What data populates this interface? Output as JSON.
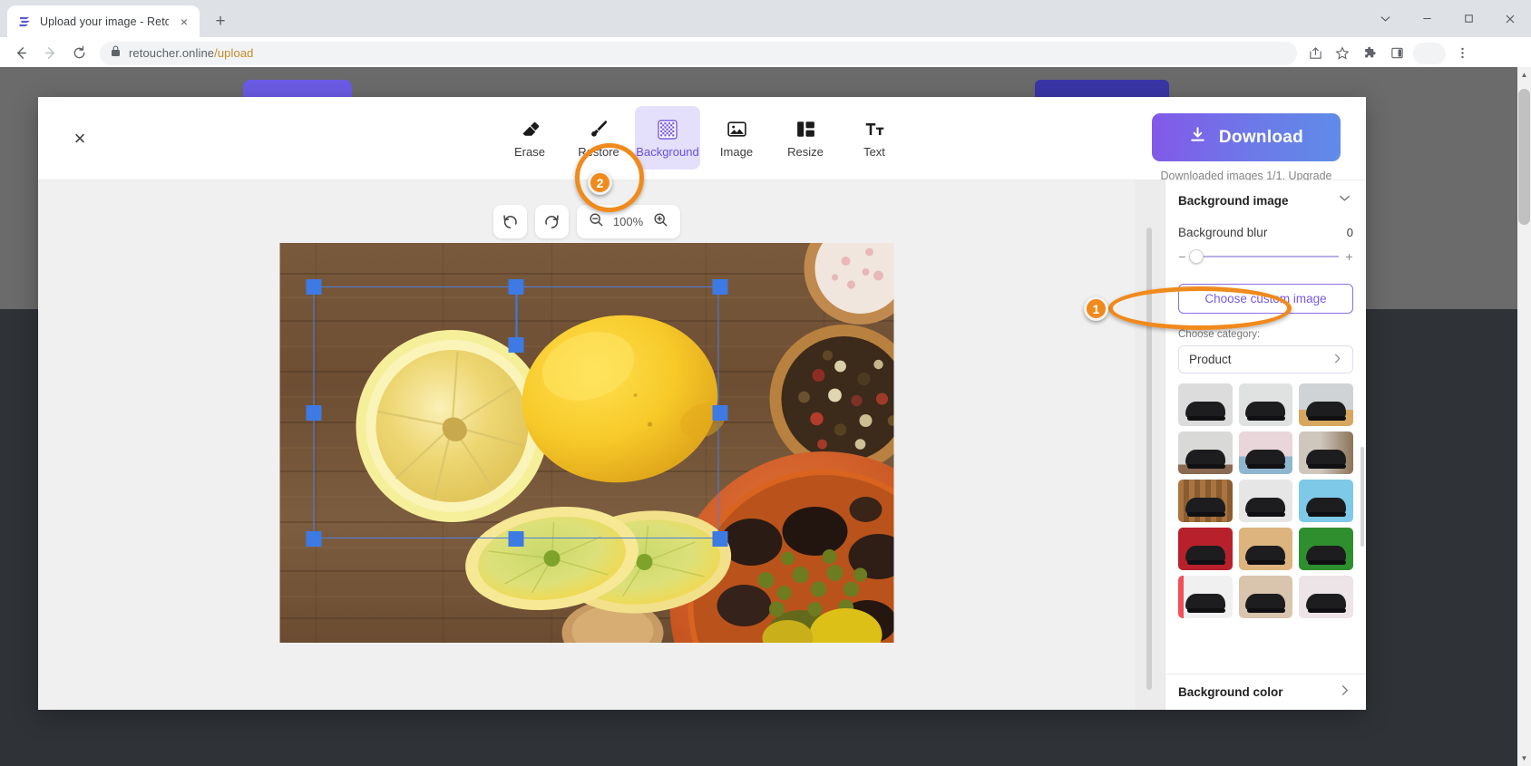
{
  "browser": {
    "tab": {
      "title": "Upload your image - Retoucher.",
      "favicon": "retoucher-logo-icon",
      "close": "×"
    },
    "new_tab_label": "+",
    "window_controls": [
      "chevron-down-icon",
      "minimize-icon",
      "maximize-icon",
      "close-icon"
    ],
    "nav": {
      "back": "←",
      "forward": "→",
      "reload": "⟳"
    },
    "omnibox": {
      "lock": "lock-icon",
      "domain": "retoucher.online",
      "path": "/upload",
      "url_full": "retoucher.online/upload"
    },
    "toolbar_icons": [
      "share-icon",
      "bookmark-star-icon",
      "extensions-puzzle-icon",
      "side-panel-icon",
      "more-menu-icon"
    ]
  },
  "modal": {
    "close_label": "×",
    "tools": [
      {
        "label": "Erase",
        "icon": "eraser-icon",
        "active": false
      },
      {
        "label": "Restore",
        "icon": "brush-icon",
        "active": false
      },
      {
        "label": "Background",
        "icon": "checkerboard-icon",
        "active": true
      },
      {
        "label": "Image",
        "icon": "picture-icon",
        "active": false
      },
      {
        "label": "Resize",
        "icon": "resize-icon",
        "active": false
      },
      {
        "label": "Text",
        "icon": "text-tt-icon",
        "active": false
      }
    ],
    "download": {
      "label": "Download",
      "icon": "download-arrow-icon",
      "note_prefix": "Downloaded images 1/1. ",
      "note_link": "Upgrade"
    },
    "canvas": {
      "undo_icon": "undo-icon",
      "redo_icon": "redo-icon",
      "zoom_out_icon": "zoom-out-icon",
      "zoom_in_icon": "zoom-in-icon",
      "zoom_level": "100%",
      "image_alt": "lemons-and-spices-on-wood-photo",
      "selection": "transform-selection-box"
    }
  },
  "panel": {
    "title": "Background image",
    "collapse_icon": "chevron-down-icon",
    "blur": {
      "label": "Background blur",
      "value": "0",
      "minus": "−",
      "plus": "+"
    },
    "choose_custom_label": "Choose custom image",
    "category": {
      "label": "Choose category:",
      "selected": "Product",
      "chevron": "chevron-right-icon"
    },
    "thumbnails": [
      {
        "name": "sneaker-grey-studio",
        "bg": "#dcdcdc",
        "accent": "#f1f1f1"
      },
      {
        "name": "sneaker-white-marble",
        "bg": "#dfe2e0",
        "accent": "#cfd6d2"
      },
      {
        "name": "sneaker-wood-tan",
        "bg": "#cfd3d6",
        "accent": "#d8a75f"
      },
      {
        "name": "sneaker-shelf-grey",
        "bg": "#d9d9d7",
        "accent": "#8a6a52"
      },
      {
        "name": "sneaker-pink-blue",
        "bg": "#e9d6da",
        "accent": "#8fb6cf"
      },
      {
        "name": "sneaker-room-window",
        "bg": "#cfc6bd",
        "accent": "#8c7358"
      },
      {
        "name": "sneaker-wood-plank",
        "bg": "#a9743f",
        "accent": "#8a5c30"
      },
      {
        "name": "sneaker-white-fabric",
        "bg": "#e6e6e6",
        "accent": "#d4d4d4"
      },
      {
        "name": "sneaker-blue-water",
        "bg": "#7ec8e8",
        "accent": "#a9dcf0"
      },
      {
        "name": "sneaker-red-cloth",
        "bg": "#b8202c",
        "accent": "#8f1620"
      },
      {
        "name": "sneaker-beige-sand",
        "bg": "#ddb37e",
        "accent": "#c99a63"
      },
      {
        "name": "sneaker-green-leaf",
        "bg": "#2f8f2f",
        "accent": "#1f6b1f"
      },
      {
        "name": "sneaker-red-light",
        "bg": "#f0f0f0",
        "accent": "#f1505a"
      },
      {
        "name": "sneaker-fur-beige",
        "bg": "#d9c5ae",
        "accent": "#c2a98c"
      },
      {
        "name": "sneaker-pale-pink",
        "bg": "#ece4e6",
        "accent": "#d8c8cc"
      }
    ],
    "footer_title": "Background color",
    "footer_chevron": "chevron-right-icon"
  },
  "annotations": [
    {
      "id": "1",
      "target": "choose-custom-image-button",
      "shape": "ellipse"
    },
    {
      "id": "2",
      "target": "image-tool-button",
      "shape": "circle"
    }
  ],
  "colors": {
    "accent_purple": "#7a5ce4",
    "annotation_orange": "#f08a1c",
    "selection_blue": "#3d7ae4",
    "tool_active_bg": "#e4e0fb"
  }
}
